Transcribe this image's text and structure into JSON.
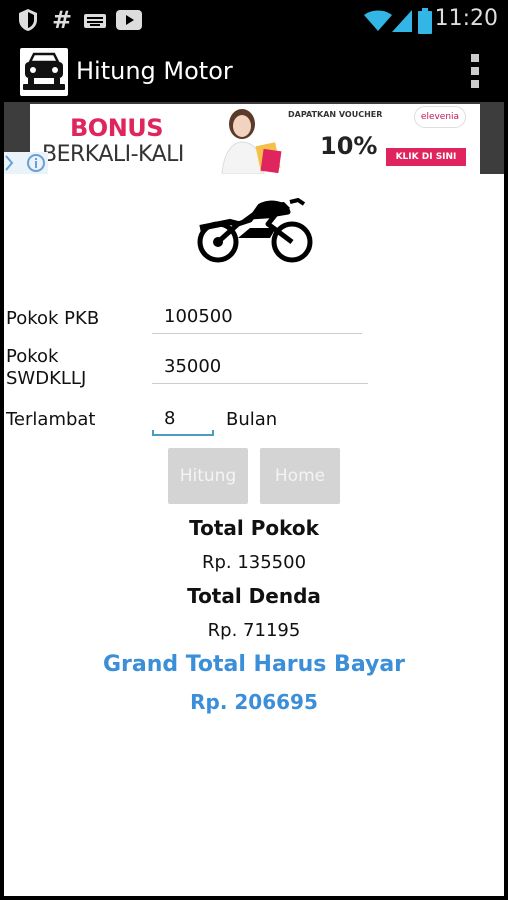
{
  "status_bar": {
    "time": "11:20",
    "icons": [
      "shield-icon",
      "hash-icon",
      "keyboard-icon",
      "youtube-icon",
      "wifi-icon",
      "signal-icon",
      "battery-icon"
    ]
  },
  "action_bar": {
    "title": "Hitung Motor",
    "logo_icon": "car-icon",
    "overflow_icon": "overflow-menu-icon"
  },
  "ad_banner": {
    "headline": "BONUS",
    "subline": "BERKALI-KALI",
    "voucher_text": "DAPATKAN VOUCHER",
    "percent": "10%",
    "brand": "elevenia",
    "cta": "KLIK DI SINI",
    "accent_color": "#e0245e"
  },
  "form": {
    "pokok_pkb_label": "Pokok PKB",
    "pokok_pkb_value": "100500",
    "pokok_swdkllj_label_1": "Pokok",
    "pokok_swdkllj_label_2": "SWDKLLJ",
    "pokok_swdkllj_value": "35000",
    "terlambat_label": "Terlambat",
    "terlambat_value": "8",
    "bulan_label": "Bulan"
  },
  "buttons": {
    "hitung": "Hitung",
    "home": "Home"
  },
  "results": {
    "total_pokok_label": "Total Pokok",
    "total_pokok_value": "Rp. 135500",
    "total_denda_label": "Total Denda",
    "total_denda_value": "Rp. 71195",
    "grand_total_label": "Grand Total Harus Bayar",
    "grand_total_value": "Rp. 206695",
    "accent_color": "#3b8ed8"
  }
}
